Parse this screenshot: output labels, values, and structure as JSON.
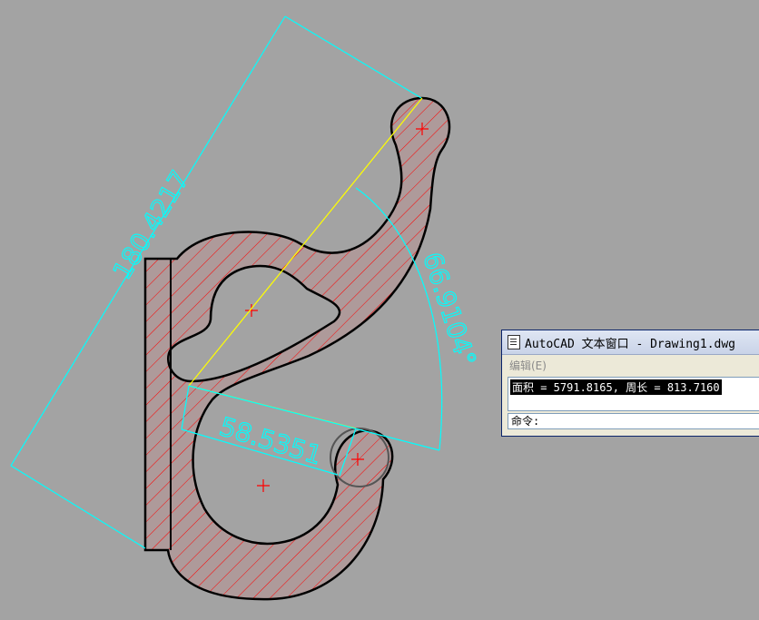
{
  "drawing": {
    "dimensions": {
      "overall_length": "180.4217",
      "angle": "66.9104°",
      "short_length": "58.5351"
    },
    "colors": {
      "background": "#a3a3a3",
      "outline": "#000000",
      "hatch": "#ff0000",
      "dimension": "#00ffff",
      "construction": "#ffff00"
    }
  },
  "text_window": {
    "title": "AutoCAD 文本窗口 - Drawing1.dwg",
    "menu_edit": "编辑(E)",
    "output_line": "面积 = 5791.8165, 周长 = 813.7160",
    "command_prompt": "命令:"
  }
}
